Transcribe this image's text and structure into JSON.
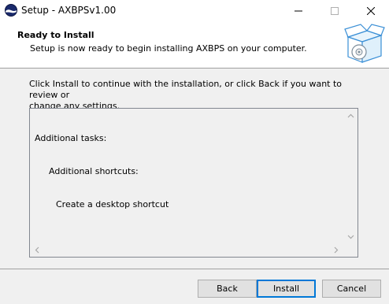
{
  "window": {
    "title": "Setup - AXBPSv1.00",
    "controls": {
      "minimize": "—",
      "maximize": "☐",
      "close": "✕"
    },
    "icon": "setup-app-icon"
  },
  "header": {
    "title": "Ready to Install",
    "subtitle": "Setup is now ready to begin installing AXBPS on your computer.",
    "image": "install-box-icon"
  },
  "body": {
    "intro_line1": "Click Install to continue with the installation, or click Back if you want to review or",
    "intro_line2": "change any settings.",
    "memo": {
      "line1": "Additional tasks:",
      "line2": "Additional shortcuts:",
      "line3": "Create a desktop shortcut"
    }
  },
  "buttons": {
    "back": "Back",
    "install": "Install",
    "cancel": "Cancel"
  },
  "colors": {
    "accent": "#0078d7",
    "background": "#f0f0f0"
  }
}
